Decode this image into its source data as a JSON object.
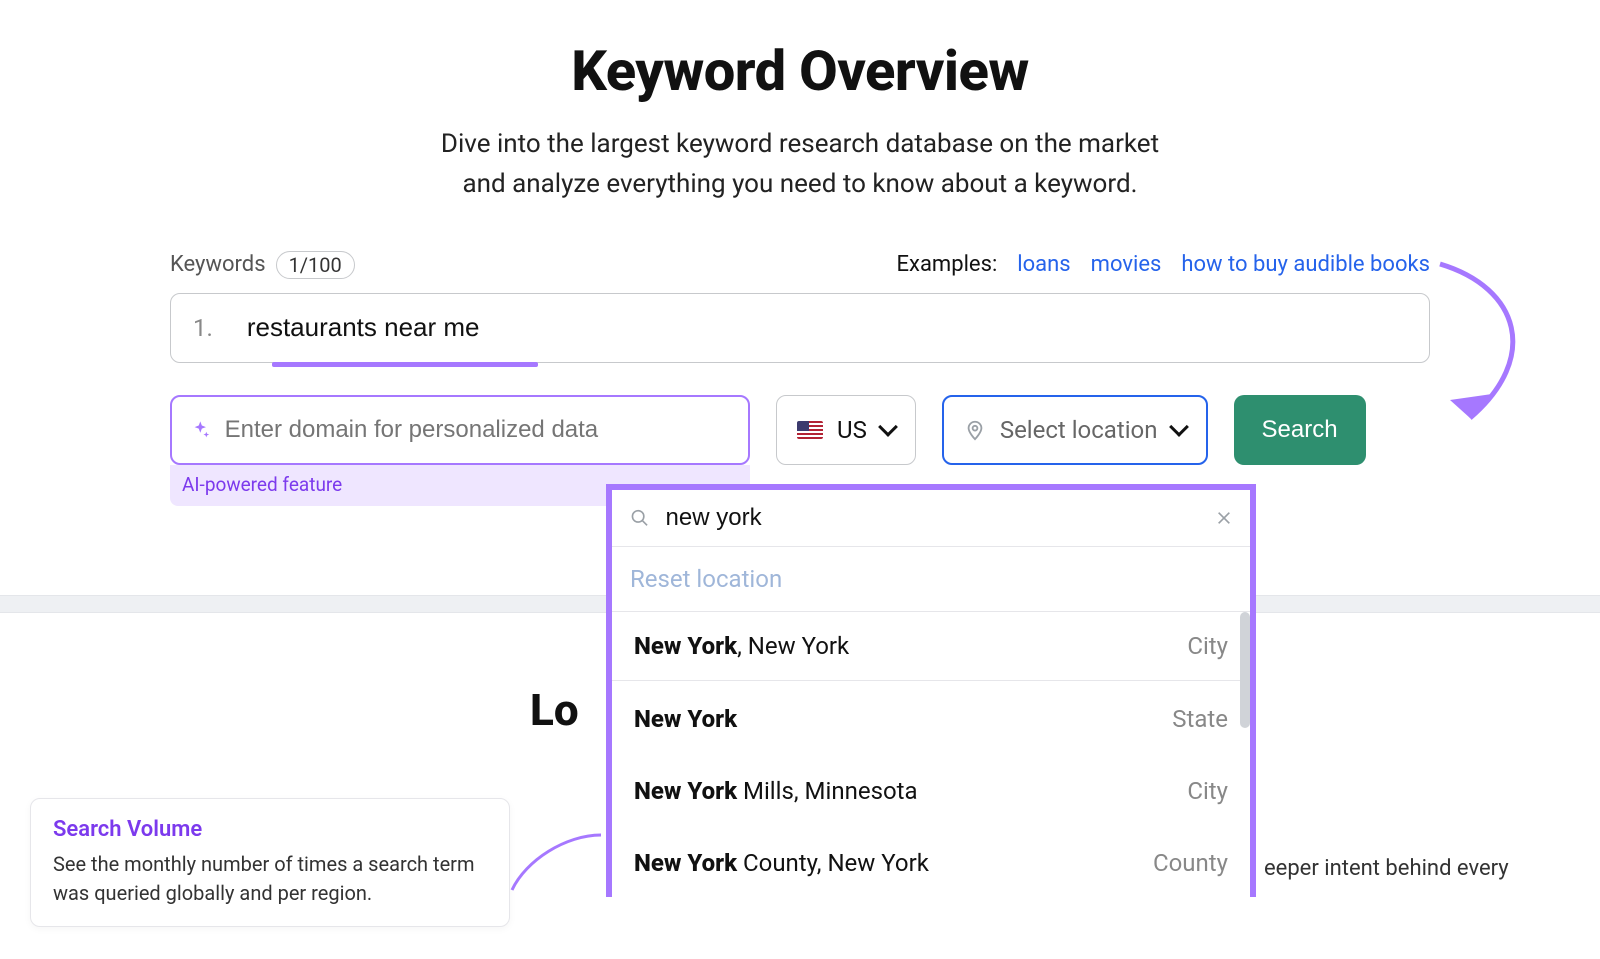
{
  "hero": {
    "title": "Keyword Overview",
    "subtitle_line1": "Dive into the largest keyword research database on the market",
    "subtitle_line2": "and analyze everything you need to know about a keyword."
  },
  "keywords": {
    "label": "Keywords",
    "counter": "1/100",
    "index": "1.",
    "value": "restaurants near me"
  },
  "examples": {
    "label": "Examples:",
    "items": [
      "loans",
      "movies",
      "how to buy audible books"
    ]
  },
  "domain": {
    "placeholder": "Enter domain for personalized data",
    "ai_label": "AI-powered feature"
  },
  "database": {
    "code": "US"
  },
  "location_select": {
    "placeholder": "Select location"
  },
  "search_button": "Search",
  "dropdown": {
    "query": "new york",
    "reset": "Reset location",
    "items": [
      {
        "bold": "New York",
        "rest": ", New York",
        "cat": "City"
      },
      {
        "bold": "New York",
        "rest": "",
        "cat": "State"
      },
      {
        "bold": "New York",
        "rest": " Mills, Minnesota",
        "cat": "City"
      },
      {
        "bold": "New York",
        "rest": " County, New York",
        "cat": "County"
      }
    ]
  },
  "partial_heading": "Lo",
  "tooltip": {
    "title": "Search Volume",
    "body": "See the monthly number of times a search term was queried globally and per region."
  },
  "right_fragment": "eeper intent behind every"
}
